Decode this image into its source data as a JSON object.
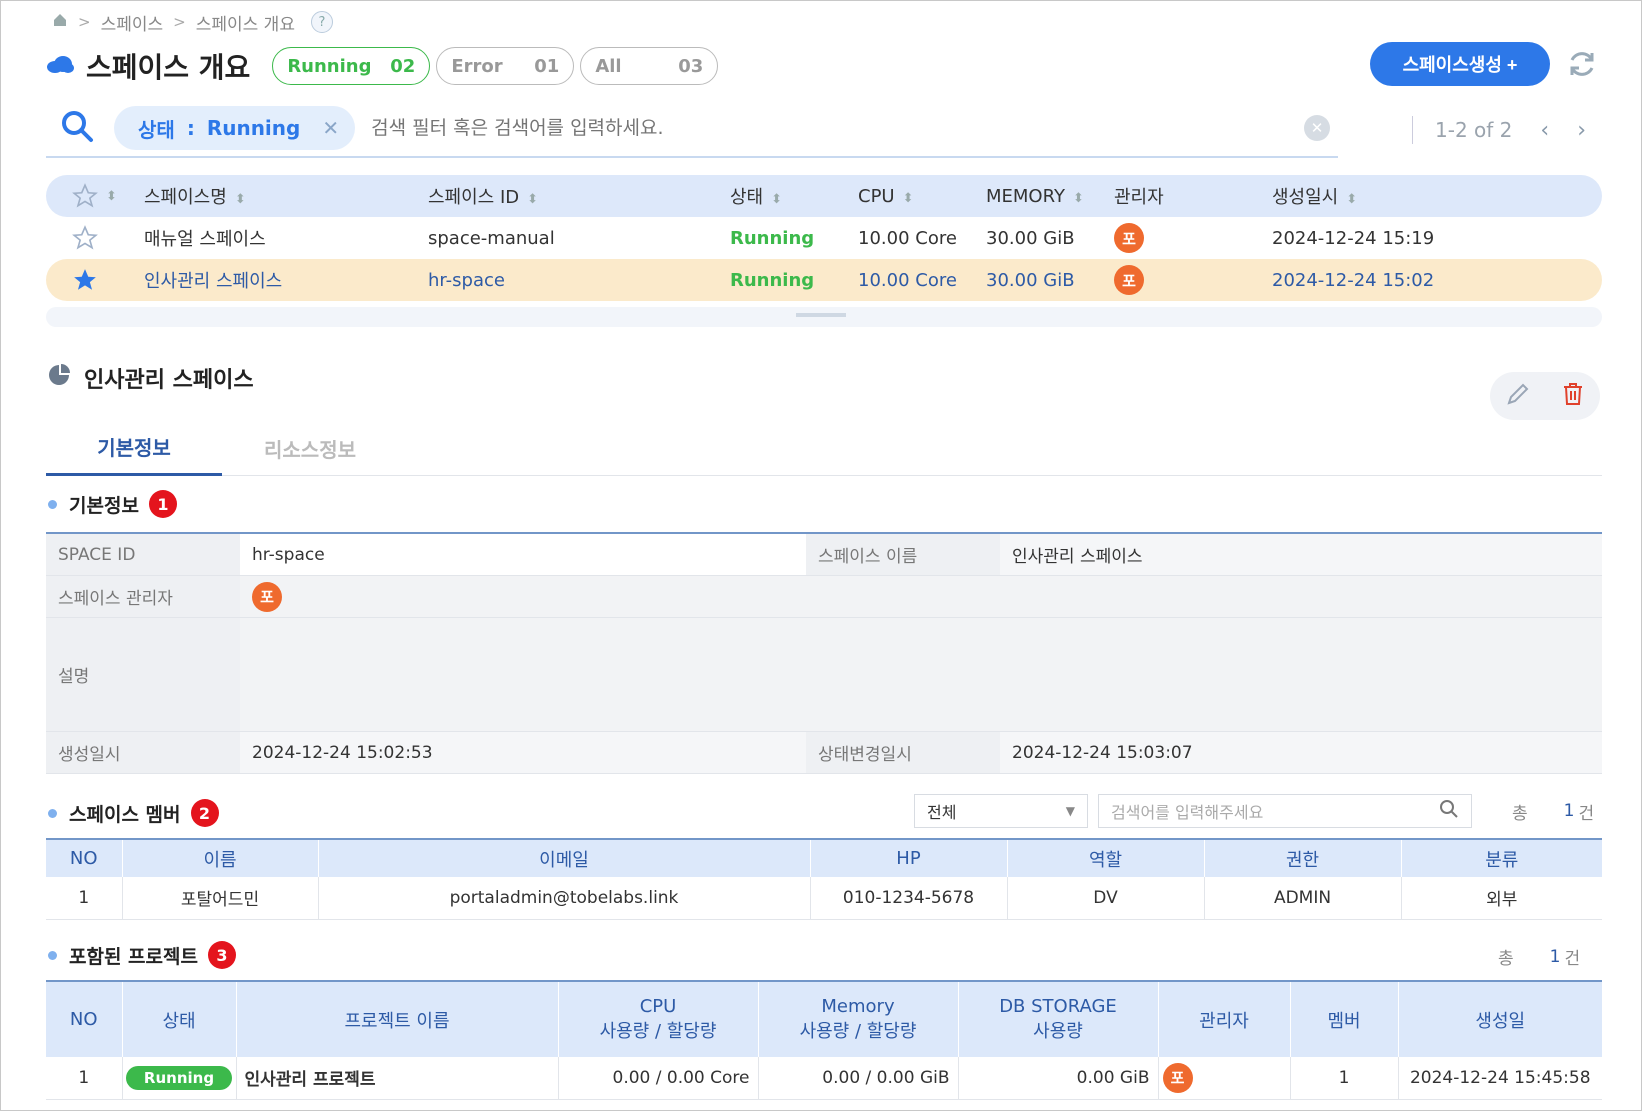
{
  "breadcrumb": {
    "home_icon": "home-icon",
    "items": [
      "스페이스",
      "스페이스 개요"
    ],
    "help": "?"
  },
  "page_title": "스페이스 개요",
  "status_pills": [
    {
      "label": "Running",
      "count": "02",
      "active": true
    },
    {
      "label": "Error",
      "count": "01",
      "active": false
    },
    {
      "label": "All",
      "count": "03",
      "active": false
    }
  ],
  "create_button": "스페이스생성 +",
  "search": {
    "chip_key": "상태",
    "chip_sep": ":",
    "chip_value": "Running",
    "chip_close": "✕",
    "placeholder": "검색 필터 혹은 검색어를 입력하세요.",
    "pager": "1-2 of 2"
  },
  "space_table": {
    "headers": [
      "스페이스명",
      "스페이스 ID",
      "상태",
      "CPU",
      "MEMORY",
      "관리자",
      "생성일시"
    ],
    "rows": [
      {
        "starred": false,
        "name": "매뉴얼 스페이스",
        "id": "space-manual",
        "status": "Running",
        "cpu": "10.00 Core",
        "memory": "30.00 GiB",
        "manager": "포",
        "created": "2024-12-24 15:19"
      },
      {
        "starred": true,
        "name": "인사관리 스페이스",
        "id": "hr-space",
        "status": "Running",
        "cpu": "10.00 Core",
        "memory": "30.00 GiB",
        "manager": "포",
        "created": "2024-12-24 15:02"
      }
    ]
  },
  "detail": {
    "title": "인사관리 스페이스",
    "tabs": [
      "기본정보",
      "리소스정보"
    ],
    "section1": {
      "title": "기본정보",
      "badge": "1"
    },
    "info": {
      "space_id_label": "SPACE ID",
      "space_id": "hr-space",
      "space_name_label": "스페이스 이름",
      "space_name": "인사관리 스페이스",
      "manager_label": "스페이스 관리자",
      "manager": "포",
      "desc_label": "설명",
      "desc": "",
      "created_label": "생성일시",
      "created": "2024-12-24 15:02:53",
      "changed_label": "상태변경일시",
      "changed": "2024-12-24 15:03:07"
    },
    "section2": {
      "title": "스페이스 멤버",
      "badge": "2",
      "filter": "전체",
      "search_placeholder": "검색어를 입력해주세요",
      "total_label": "총",
      "total": "1",
      "unit": "건"
    },
    "members": {
      "headers": [
        "NO",
        "이름",
        "이메일",
        "HP",
        "역할",
        "권한",
        "분류"
      ],
      "rows": [
        [
          "1",
          "포탈어드민",
          "portaladmin@tobelabs.link",
          "010-1234-5678",
          "DV",
          "ADMIN",
          "외부"
        ]
      ]
    },
    "section3": {
      "title": "포함된 프로젝트",
      "badge": "3",
      "total_label": "총",
      "total": "1",
      "unit": "건"
    },
    "projects": {
      "headers": [
        "NO",
        "상태",
        "프로젝트 이름",
        "CPU",
        "사용량 / 할당량",
        "Memory",
        "사용량 / 할당량",
        "DB STORAGE",
        "사용량",
        "관리자",
        "멤버",
        "생성일"
      ],
      "rows": [
        {
          "no": "1",
          "status": "Running",
          "name": "인사관리 프로젝트",
          "cpu": "0.00 / 0.00 Core",
          "memory": "0.00 / 0.00 GiB",
          "db": "0.00 GiB",
          "manager": "포",
          "members": "1",
          "created": "2024-12-24 15:45:58"
        }
      ]
    }
  },
  "colors": {
    "accent": "#2d78e8",
    "running": "#3cb94b",
    "header_bg": "#dce8fa",
    "selected_row": "#fbeacb",
    "avatar": "#ef6a2e",
    "badge": "#e4141d"
  }
}
